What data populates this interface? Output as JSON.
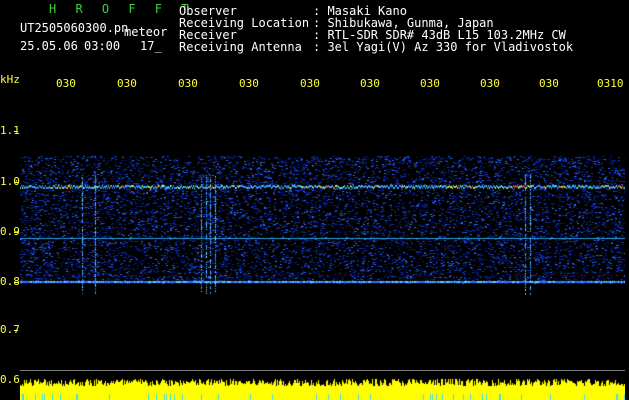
{
  "header": {
    "program": "H R O F F T",
    "filename": "UT2505060300.pn",
    "filename_suffix": "meteor",
    "date": "25.05.06",
    "time": "03:00",
    "count": "17_",
    "fields": [
      {
        "label": "Observer",
        "value": ": Masaki Kano"
      },
      {
        "label": "Receiving Location",
        "value": ": Shibukawa, Gunma, Japan"
      },
      {
        "label": "Receiver",
        "value": ": RTL-SDR SDR# 43dB L15 103.2MHz CW"
      },
      {
        "label": "Receiving Antenna",
        "value": ": 3el Yagi(V) Az 330 for Vladivostok"
      }
    ]
  },
  "time_axis": {
    "ticks": [
      "030",
      "030",
      "030",
      "030",
      "030",
      "030",
      "030",
      "030",
      "030",
      "0310"
    ]
  },
  "freq_axis": {
    "unit": "kHz",
    "labels": [
      "1.1",
      "1.0",
      "0.9",
      "0.8",
      "0.7",
      "0.6"
    ]
  },
  "colors": {
    "text": "#ffffff",
    "title": "#3fd03f",
    "axis": "#ffff3a",
    "background": "#000000",
    "noise_floor": "#ffff00"
  }
}
